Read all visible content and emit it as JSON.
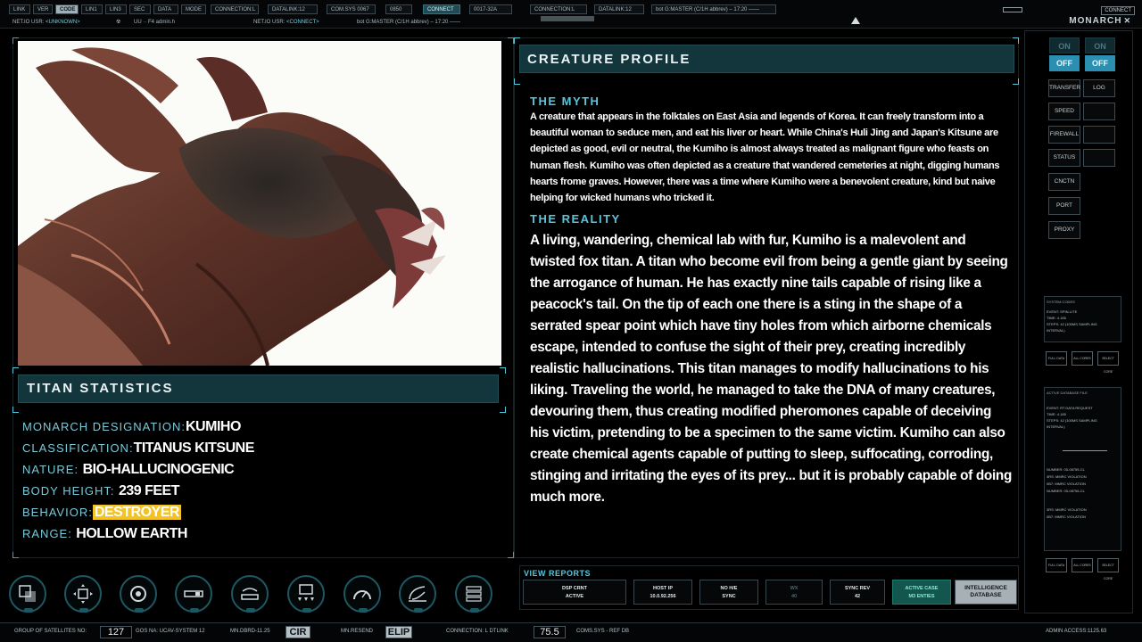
{
  "topbar": {
    "tabs": [
      "LINK",
      "VER",
      "CODE",
      "LIN1",
      "LIN3",
      "SEC",
      "DATA",
      "MODE"
    ],
    "active_tab": "CODE",
    "connection": "CONNECTION:L",
    "datalink": "DATALINK:12",
    "com_sys": "COM.SYS 0067",
    "code_0850": "0850",
    "connect_btn": "CONNECT",
    "code_0017": "0017-32A",
    "connection_2": "CONNECTION:L",
    "datalink_2": "DATALINK:12",
    "bot_master": "bot G:MASTER (C/1H abbrev) – 17:20 ——",
    "connect_right": "CONNECT",
    "brand": "MONARCH",
    "net_usr_label": "NET.IO USR:",
    "net_usr_value": "<UNKNOWN>",
    "uu_text": "UU  ·· F4 admin.h",
    "net_usr_label_2": "NET.IO USR:",
    "net_usr_value_2": "<CONNECT>",
    "bot_master_2": "bot G:MASTER (C/1H abbrev) – 17:20 ——"
  },
  "profile": {
    "header": "CREATURE PROFILE",
    "myth_title": "THE MYTH",
    "myth_text": "A creature that appears in the folktales on East Asia and legends of Korea. It can freely transform into a beautiful woman to seduce men, and eat his liver or heart. While China's Huli Jing and Japan's Kitsune are depicted as good, evil or neutral, the Kumiho is almost always treated as malignant figure who feasts on human flesh. Kumiho was often depicted as a creature that wandered cemeteries at night, digging humans hearts frome graves. However, there was a time where Kumiho were a benevolent creature, kind but naive helping for wicked humans who tricked it.",
    "reality_title": "THE REALITY",
    "reality_text": "A living, wandering, chemical lab with fur, Kumiho is a malevolent and twisted fox titan. A titan who become evil from being a gentle giant by seeing the arrogance of human. He has exactly nine tails capable of rising like a peacock's tail. On the tip of each one there is a sting in the shape of a serrated spear point which have tiny holes from which airborne chemicals escape, intended to confuse the sight of their prey, creating incredibly realistic hallucinations. This titan manages to modify hallucinations to his liking. Traveling the world, he managed to take the DNA of many creatures, devouring them, thus creating modified pheromones capable of deceiving his victim, pretending to be a specimen to the same victim. Kumiho can also create chemical agents capable of putting to sleep, suffocating, corroding, stinging and irritating the eyes of its prey... but it is probably capable of doing much more."
  },
  "stats": {
    "header": "TITAN STATISTICS",
    "rows": [
      {
        "label": "MONARCH DESIGNATION:",
        "value": "KUMIHO"
      },
      {
        "label": "CLASSIFICATION:",
        "value": "TITANUS KITSUNE"
      },
      {
        "label": "NATURE:",
        "value": "BIO-HALLUCINOGENIC"
      },
      {
        "label": "BODY HEIGHT:",
        "value": "239 FEET"
      },
      {
        "label": "BEHAVIOR:",
        "value": "DESTROYER"
      },
      {
        "label": "RANGE:",
        "value": "HOLLOW EARTH"
      }
    ]
  },
  "side": {
    "on1": "ON",
    "off1": "OFF",
    "on2": "ON",
    "off2": "OFF",
    "buttons": [
      "TRANSFER",
      "LOG",
      "SPEED",
      "FIREWALL",
      "STATUS",
      "CNCTN",
      "PORT",
      "PROXY"
    ],
    "panel1": {
      "title": "SYSTEM CODES",
      "lines": [
        "EVENT:      SPIN-LITE",
        "TIME:       4.185",
        "STEPS:      42 (100MS SAMPLING",
        "INTERVAL)"
      ]
    },
    "panel1_buttons": [
      "FULL DATA",
      "ALL CORES",
      "SELECT CORE"
    ],
    "panel2": {
      "title": "ACTIVE DATABASE FILE",
      "lines": [
        "EVENT:      RT DATA REQUEST",
        "TIME:       4.185",
        "STEPS:      42 (100MS SAMPLING",
        "INTERVAL)",
        "",
        "",
        "NUMBER:   05-08755-CL",
        "3RS:        MMRC VIOLATION",
        "0B7:        MMRC VIOLATION",
        "NUMBER:   05-08756-CL",
        "",
        "3RS:        MMRC VIOLATION",
        "0B7:        MMRC VIOLATION"
      ]
    },
    "panel2_buttons": [
      "FULL DATA",
      "ALL CORES",
      "SELECT CORE"
    ]
  },
  "reports": {
    "title": "VIEW REPORTS",
    "items": [
      {
        "l1": "DSP CRNT",
        "l2": "ACTIVE"
      },
      {
        "l1": "HOST IP",
        "l2": "10.0.92.256"
      },
      {
        "l1": "NO H/E",
        "l2": "SYNC"
      },
      {
        "l1": "WX",
        "l2": "40"
      },
      {
        "l1": "SYNC REV",
        "l2": "42"
      },
      {
        "l1": "ACTIVE CASE",
        "l2": "M3 ENTIES"
      },
      {
        "l1": "INTELLIGENCE",
        "l2": "DATABASE"
      }
    ]
  },
  "bottom": {
    "satellites_label": "GROUP OF SATELLITES NO:",
    "satellites_value": "127",
    "gos": "GOS NA: UCAV-SYSTEM 12",
    "mn_dbrd": "MN.DBRD-11.25",
    "cir": "CIR",
    "mn_resend": "MN.RESEND",
    "elip": "ELIP",
    "connection": "CONNECTION: L DTLINK",
    "value_755": "75.5",
    "coms": "COMS.SYS - REF DB",
    "admin": "ADMIN ACCESS:1125.63"
  },
  "colors": {
    "accent": "#56c6dc",
    "header_bg": "#13363c",
    "warning": "#f3c224"
  },
  "icons": [
    "layers-icon",
    "move-arrows-icon",
    "target-icon",
    "slider-icon",
    "signal-icon",
    "monitor-network-icon",
    "gauge-icon",
    "radar-icon",
    "stack-icon"
  ]
}
